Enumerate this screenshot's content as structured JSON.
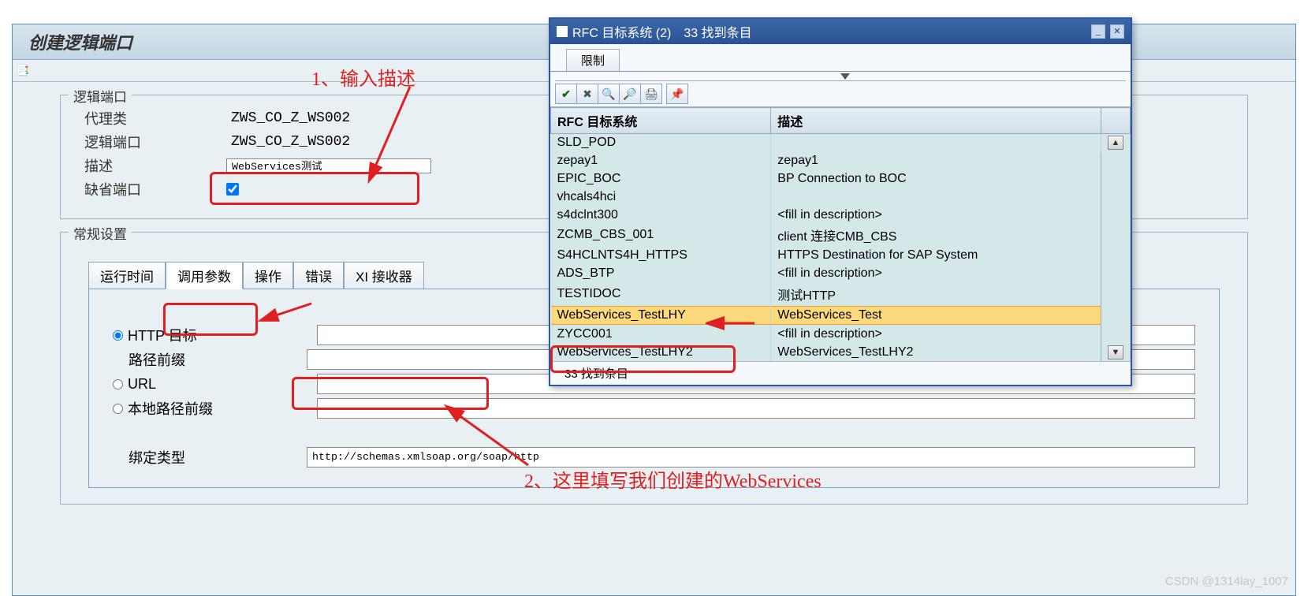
{
  "page": {
    "title": "创建逻辑端口"
  },
  "form": {
    "groupLabel": "逻辑端口",
    "proxyClassLabel": "代理类",
    "proxyClassValue": "ZWS_CO_Z_WS002",
    "portLabel": "逻辑端口",
    "portValue": "ZWS_CO_Z_WS002",
    "descLabel": "描述",
    "descValue": "WebServices测试",
    "defaultPortLabel": "缺省端口"
  },
  "settings": {
    "groupLabel": "常规设置",
    "tabs": [
      "运行时间",
      "调用参数",
      "操作",
      "错误",
      "XI 接收器"
    ],
    "httpTargetLabel": "HTTP 目标",
    "pathPrefixLabel": "路径前缀",
    "urlLabel": "URL",
    "localPathPrefixLabel": "本地路径前缀",
    "bindingTypeLabel": "绑定类型",
    "bindingTypeValue": "http://schemas.xmlsoap.org/soap/http"
  },
  "popup": {
    "title": "RFC 目标系统 (2)",
    "subtitle": "33 找到条目",
    "tabLabel": "限制",
    "columns": [
      "RFC 目标系统",
      "描述"
    ],
    "rows": [
      {
        "rfc": "SLD_POD",
        "desc": ""
      },
      {
        "rfc": "zepay1",
        "desc": "zepay1"
      },
      {
        "rfc": "EPIC_BOC",
        "desc": "BP Connection to BOC"
      },
      {
        "rfc": "vhcals4hci",
        "desc": ""
      },
      {
        "rfc": "s4dclnt300",
        "desc": "<fill in description>"
      },
      {
        "rfc": "ZCMB_CBS_001",
        "desc": "client 连接CMB_CBS"
      },
      {
        "rfc": "S4HCLNTS4H_HTTPS",
        "desc": "HTTPS Destination for SAP System"
      },
      {
        "rfc": "ADS_BTP",
        "desc": "<fill in description>"
      },
      {
        "rfc": "TESTIDOC",
        "desc": "测试HTTP"
      },
      {
        "rfc": "WebServices_TestLHY",
        "desc": "WebServices_Test",
        "selected": true
      },
      {
        "rfc": "ZYCC001",
        "desc": "<fill in description>"
      },
      {
        "rfc": "WebServices_TestLHY2",
        "desc": "WebServices_TestLHY2"
      }
    ],
    "footer": "33 找到条目"
  },
  "annotations": {
    "a1": "1、输入描述",
    "a2": "2、这里填写我们创建的WebServices"
  },
  "watermark": "CSDN @1314lay_1007"
}
